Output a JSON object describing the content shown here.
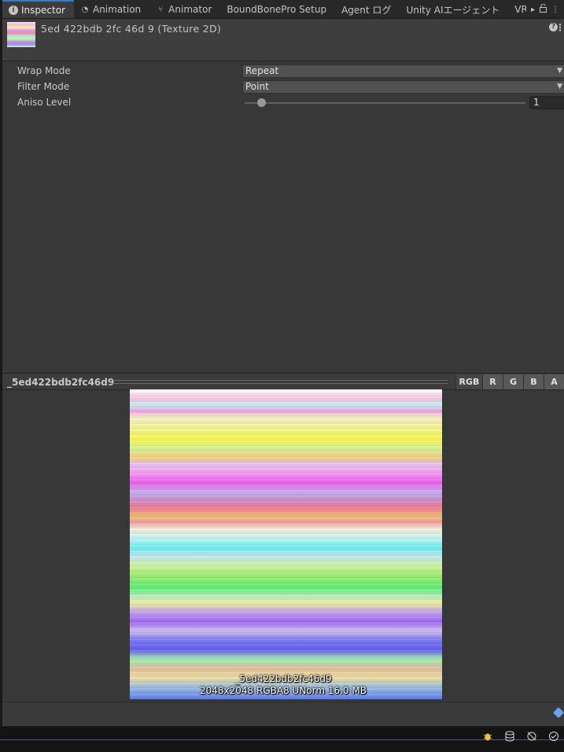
{
  "tabs": [
    {
      "label": "Inspector",
      "icon": "info-icon",
      "active": true
    },
    {
      "label": "Animation",
      "icon": "clock-icon"
    },
    {
      "label": "Animator",
      "icon": "animator-icon"
    },
    {
      "label": "BoundBonePro Setup"
    },
    {
      "label": "Agent ログ"
    },
    {
      "label": "Unity AIエージェント"
    },
    {
      "label": "VRCha"
    }
  ],
  "tab_tools": {
    "more": "▸",
    "lock": "🔓",
    "menu": "⋮"
  },
  "header": {
    "title": "5ed 422bdb 2fc 46d 9 (Texture 2D)",
    "help": "?",
    "menu": "⋮"
  },
  "properties": {
    "wrap_mode": {
      "label": "Wrap Mode",
      "value": "Repeat"
    },
    "filter_mode": {
      "label": "Filter Mode",
      "value": "Point"
    },
    "aniso_level": {
      "label": "Aniso Level",
      "value": "1",
      "slider_fraction": 0.06
    }
  },
  "preview": {
    "name": "_5ed422bdb2fc46d9",
    "channels": [
      "RGB",
      "R",
      "G",
      "B",
      "A"
    ],
    "active_channel": "RGB",
    "caption_name": "_5ed422bdb2fc46d9",
    "caption_info": "2048x2048  RGBA8 UNorm  16.0 MB"
  },
  "status_icons": [
    "bug-icon",
    "database-icon",
    "network-off-icon",
    "check-circle-icon"
  ]
}
